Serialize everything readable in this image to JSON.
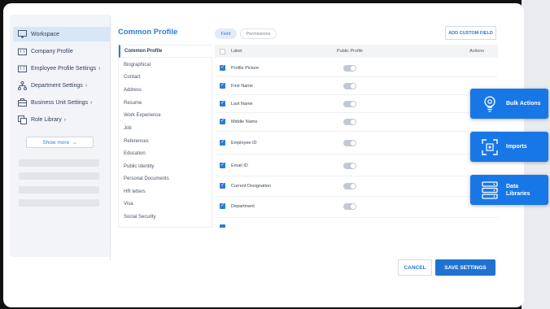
{
  "sidebar": {
    "items": [
      {
        "label": "Workspace",
        "icon": "monitor-icon",
        "active": true
      },
      {
        "label": "Company Profile",
        "icon": "building-icon"
      },
      {
        "label": "Employee Profile Settings",
        "icon": "building-icon",
        "chevron": "›"
      },
      {
        "label": "Department Settings",
        "icon": "org-chart-icon",
        "chevron": "›"
      },
      {
        "label": "Business Unit Settings",
        "icon": "briefcase-icon",
        "chevron": "›"
      },
      {
        "label": "Role Library",
        "icon": "copy-icon",
        "chevron": "›"
      }
    ],
    "show_more": "Show more",
    "show_more_icon": "⌄"
  },
  "main": {
    "title": "Common Profile",
    "tabs": [
      "Field",
      "Permissions"
    ],
    "add_button": "ADD CUSTOM FIELD",
    "sections": [
      "Common Profile",
      "Biographical",
      "Contact",
      "Address",
      "Resume",
      "Work Experience",
      "Job",
      "References",
      "Education",
      "Public Identity",
      "Personal Documents",
      "HR letters",
      "Visa",
      "Social Security"
    ],
    "table": {
      "headers": {
        "label": "Label",
        "public": "Public Profile",
        "actions": "Actions"
      },
      "rows": [
        "Profile Picture",
        "First Name",
        "Last Name",
        "Middle Name",
        "Employee ID",
        "Email ID",
        "Current Designation",
        "Department"
      ]
    },
    "cancel": "CANCEL",
    "save": "SAVE SETTINGS"
  },
  "floating": [
    {
      "label": "Bulk Actions",
      "icon": "lightbulb-gear-icon"
    },
    {
      "label": "Imports",
      "icon": "scan-icon"
    },
    {
      "label": "Data Libraries",
      "icon": "database-icon"
    }
  ],
  "colors": {
    "accent": "#2b7cd3",
    "floating": "#1877e6"
  }
}
